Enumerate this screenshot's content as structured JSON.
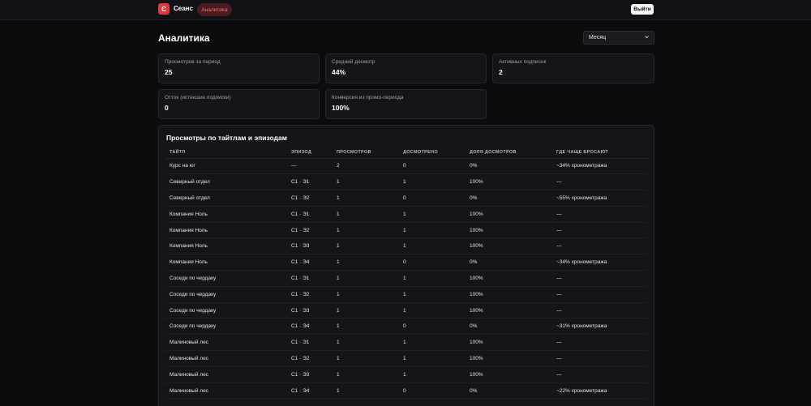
{
  "brand": {
    "logo_letter": "С",
    "name": "Сеанс"
  },
  "nav": {
    "active_item": "Аналитика",
    "logout": "Выйти"
  },
  "header": {
    "title": "Аналитика",
    "period": "Месяц"
  },
  "stats": [
    {
      "label": "Просмотров за период",
      "value": "25"
    },
    {
      "label": "Средний досмотр",
      "value": "44%"
    },
    {
      "label": "Активных подписок",
      "value": "2"
    },
    {
      "label": "Отток (истекшие подписки)",
      "value": "0"
    },
    {
      "label": "Конверсия из промо-периода",
      "value": "100%"
    }
  ],
  "table": {
    "title": "Просмотры по тайтлам и эпизодам",
    "columns": [
      "ТАЙТЛ",
      "ЭПИЗОД",
      "ПРОСМОТРОВ",
      "ДОСМОТРЕНО",
      "ДОЛЯ ДОСМОТРОВ",
      "ГДЕ ЧАЩЕ БРОСАЮТ"
    ],
    "rows": [
      [
        "Курс на юг",
        "—",
        "2",
        "0",
        "0%",
        "~34% хронометража"
      ],
      [
        "Северный отдел",
        "С1 · Э1",
        "1",
        "1",
        "100%",
        "—"
      ],
      [
        "Северный отдел",
        "С1 · Э2",
        "1",
        "0",
        "0%",
        "~55% хронометража"
      ],
      [
        "Компания Ноль",
        "С1 · Э1",
        "1",
        "1",
        "100%",
        "—"
      ],
      [
        "Компания Ноль",
        "С1 · Э2",
        "1",
        "1",
        "100%",
        "—"
      ],
      [
        "Компания Ноль",
        "С1 · Э3",
        "1",
        "1",
        "100%",
        "—"
      ],
      [
        "Компания Ноль",
        "С1 · Э4",
        "1",
        "0",
        "0%",
        "~34% хронометража"
      ],
      [
        "Соседи по чердаку",
        "С1 · Э1",
        "1",
        "1",
        "100%",
        "—"
      ],
      [
        "Соседи по чердаку",
        "С1 · Э2",
        "1",
        "1",
        "100%",
        "—"
      ],
      [
        "Соседи по чердаку",
        "С1 · Э3",
        "1",
        "1",
        "100%",
        "—"
      ],
      [
        "Соседи по чердаку",
        "С1 · Э4",
        "1",
        "0",
        "0%",
        "~31% хронометража"
      ],
      [
        "Малиновый лес",
        "С1 · Э1",
        "1",
        "1",
        "100%",
        "—"
      ],
      [
        "Малиновый лес",
        "С1 · Э2",
        "1",
        "1",
        "100%",
        "—"
      ],
      [
        "Малиновый лес",
        "С1 · Э3",
        "1",
        "1",
        "100%",
        "—"
      ],
      [
        "Малиновый лес",
        "С1 · Э4",
        "1",
        "0",
        "0%",
        "~22% хронометража"
      ]
    ]
  },
  "colors": {
    "accent": "#d83a3f",
    "background": "#0c0c0f",
    "card": "#141419"
  }
}
